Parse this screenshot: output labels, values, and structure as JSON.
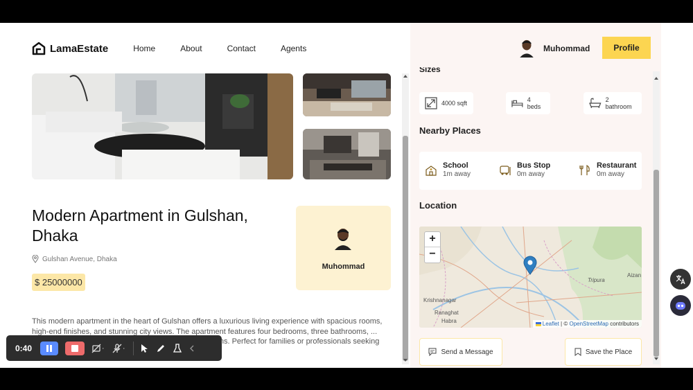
{
  "nav": {
    "brand": "LamaEstate",
    "links": [
      "Home",
      "About",
      "Contact",
      "Agents"
    ]
  },
  "header": {
    "user_name": "Muhommad",
    "profile_label": "Profile"
  },
  "listing": {
    "title": "Modern Apartment in Gulshan, Dhaka",
    "address": "Gulshan Avenue, Dhaka",
    "price": "$ 25000000",
    "owner_name": "Muhommad",
    "description": "This modern apartment in the heart of Gulshan offers a luxurious living experience with spacious rooms, high-end finishes, and stunning city views. The apartment features four bedrooms, three bathrooms, ... located in a prime area, it provides easy access ... options. Perfect for families or professionals seeking comfort and convenience in Dhaka."
  },
  "sidebar": {
    "sizes_heading": "Sizes",
    "sizes": [
      {
        "label": "4000 sqft",
        "icon": "resize-icon"
      },
      {
        "label": "4 beds",
        "icon": "bed-icon"
      },
      {
        "label": "2 bathroom",
        "icon": "bathtub-icon"
      }
    ],
    "nearby_heading": "Nearby Places",
    "nearby": [
      {
        "title": "School",
        "distance": "1m away",
        "icon": "school-icon"
      },
      {
        "title": "Bus Stop",
        "distance": "0m away",
        "icon": "bus-stop-icon"
      },
      {
        "title": "Restaurant",
        "distance": "0m away",
        "icon": "restaurant-icon"
      }
    ],
    "location_heading": "Location",
    "map": {
      "zoom_in": "+",
      "zoom_out": "−",
      "leaflet": "Leaflet",
      "attribution_sep": "| ©",
      "osm": "OpenStreetMap",
      "contributors": "contributors",
      "labels": {
        "tripura": "Tripura",
        "krishnanagar": "Krishnanagar",
        "ranaghat": "Ranaghat",
        "habra": "Habra",
        "aizan": "Aizan"
      }
    },
    "send_message": "Send a Message",
    "save_place": "Save the Place"
  },
  "recorder": {
    "time": "0:40"
  },
  "colors": {
    "accent": "#fcd551",
    "price_bg": "#fce7a7",
    "sidebar_bg": "#fcf5f3",
    "card_bg": "#fdf2d2"
  }
}
